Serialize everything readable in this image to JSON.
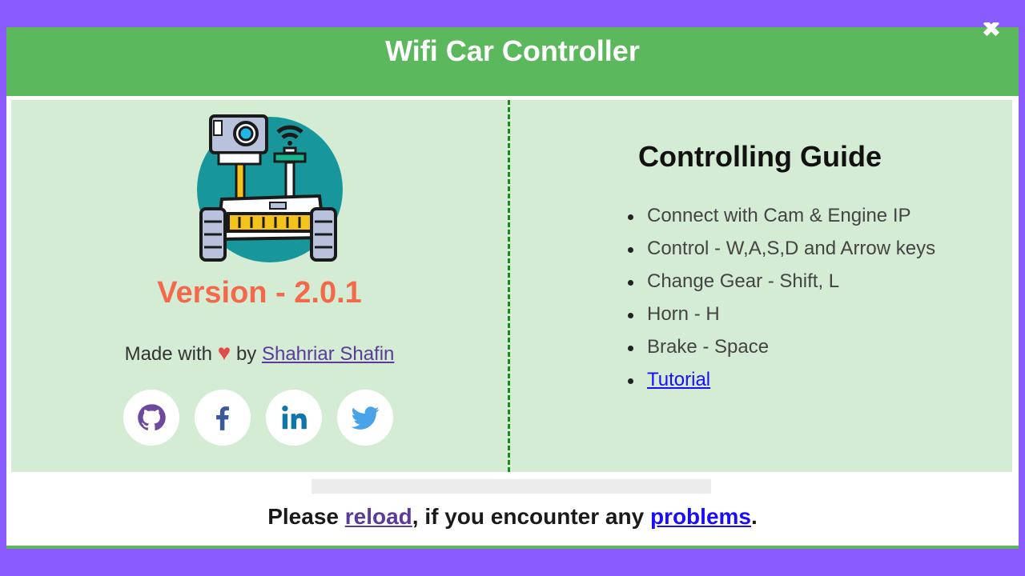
{
  "header": {
    "title": "Wifi Car Controller",
    "close_symbol": "✖"
  },
  "about": {
    "version": "Version - 2.0.1",
    "made_with_prefix": "Made with",
    "heart": "♥",
    "by": "by",
    "author": "Shahriar Shafin",
    "socials": [
      {
        "name": "github",
        "icon": "github-icon",
        "color": "#6e4a9e"
      },
      {
        "name": "facebook",
        "icon": "facebook-icon",
        "color": "#3b5998"
      },
      {
        "name": "linkedin",
        "icon": "linkedin-icon",
        "color": "#0e76a8"
      },
      {
        "name": "twitter",
        "icon": "twitter-icon",
        "color": "#4aa3e8"
      }
    ]
  },
  "guide": {
    "title": "Controlling Guide",
    "items": [
      "Connect with Cam & Engine IP",
      "Control - W,A,S,D and Arrow keys",
      "Change Gear - Shift, L",
      "Horn - H",
      "Brake - Space"
    ],
    "tutorial_label": "Tutorial"
  },
  "progress": {
    "value": 0
  },
  "footer": {
    "please": "Please",
    "reload": "reload",
    "middle": ", if you encounter any",
    "problems": "problems",
    "end": "."
  },
  "colors": {
    "page_bg": "#8a5cff",
    "header_green": "#5cb85c",
    "panel_green": "#d4ebd4",
    "version_orange": "#f4694a",
    "link_purple": "#5a3a9a",
    "link_blue": "#1a0dff"
  }
}
